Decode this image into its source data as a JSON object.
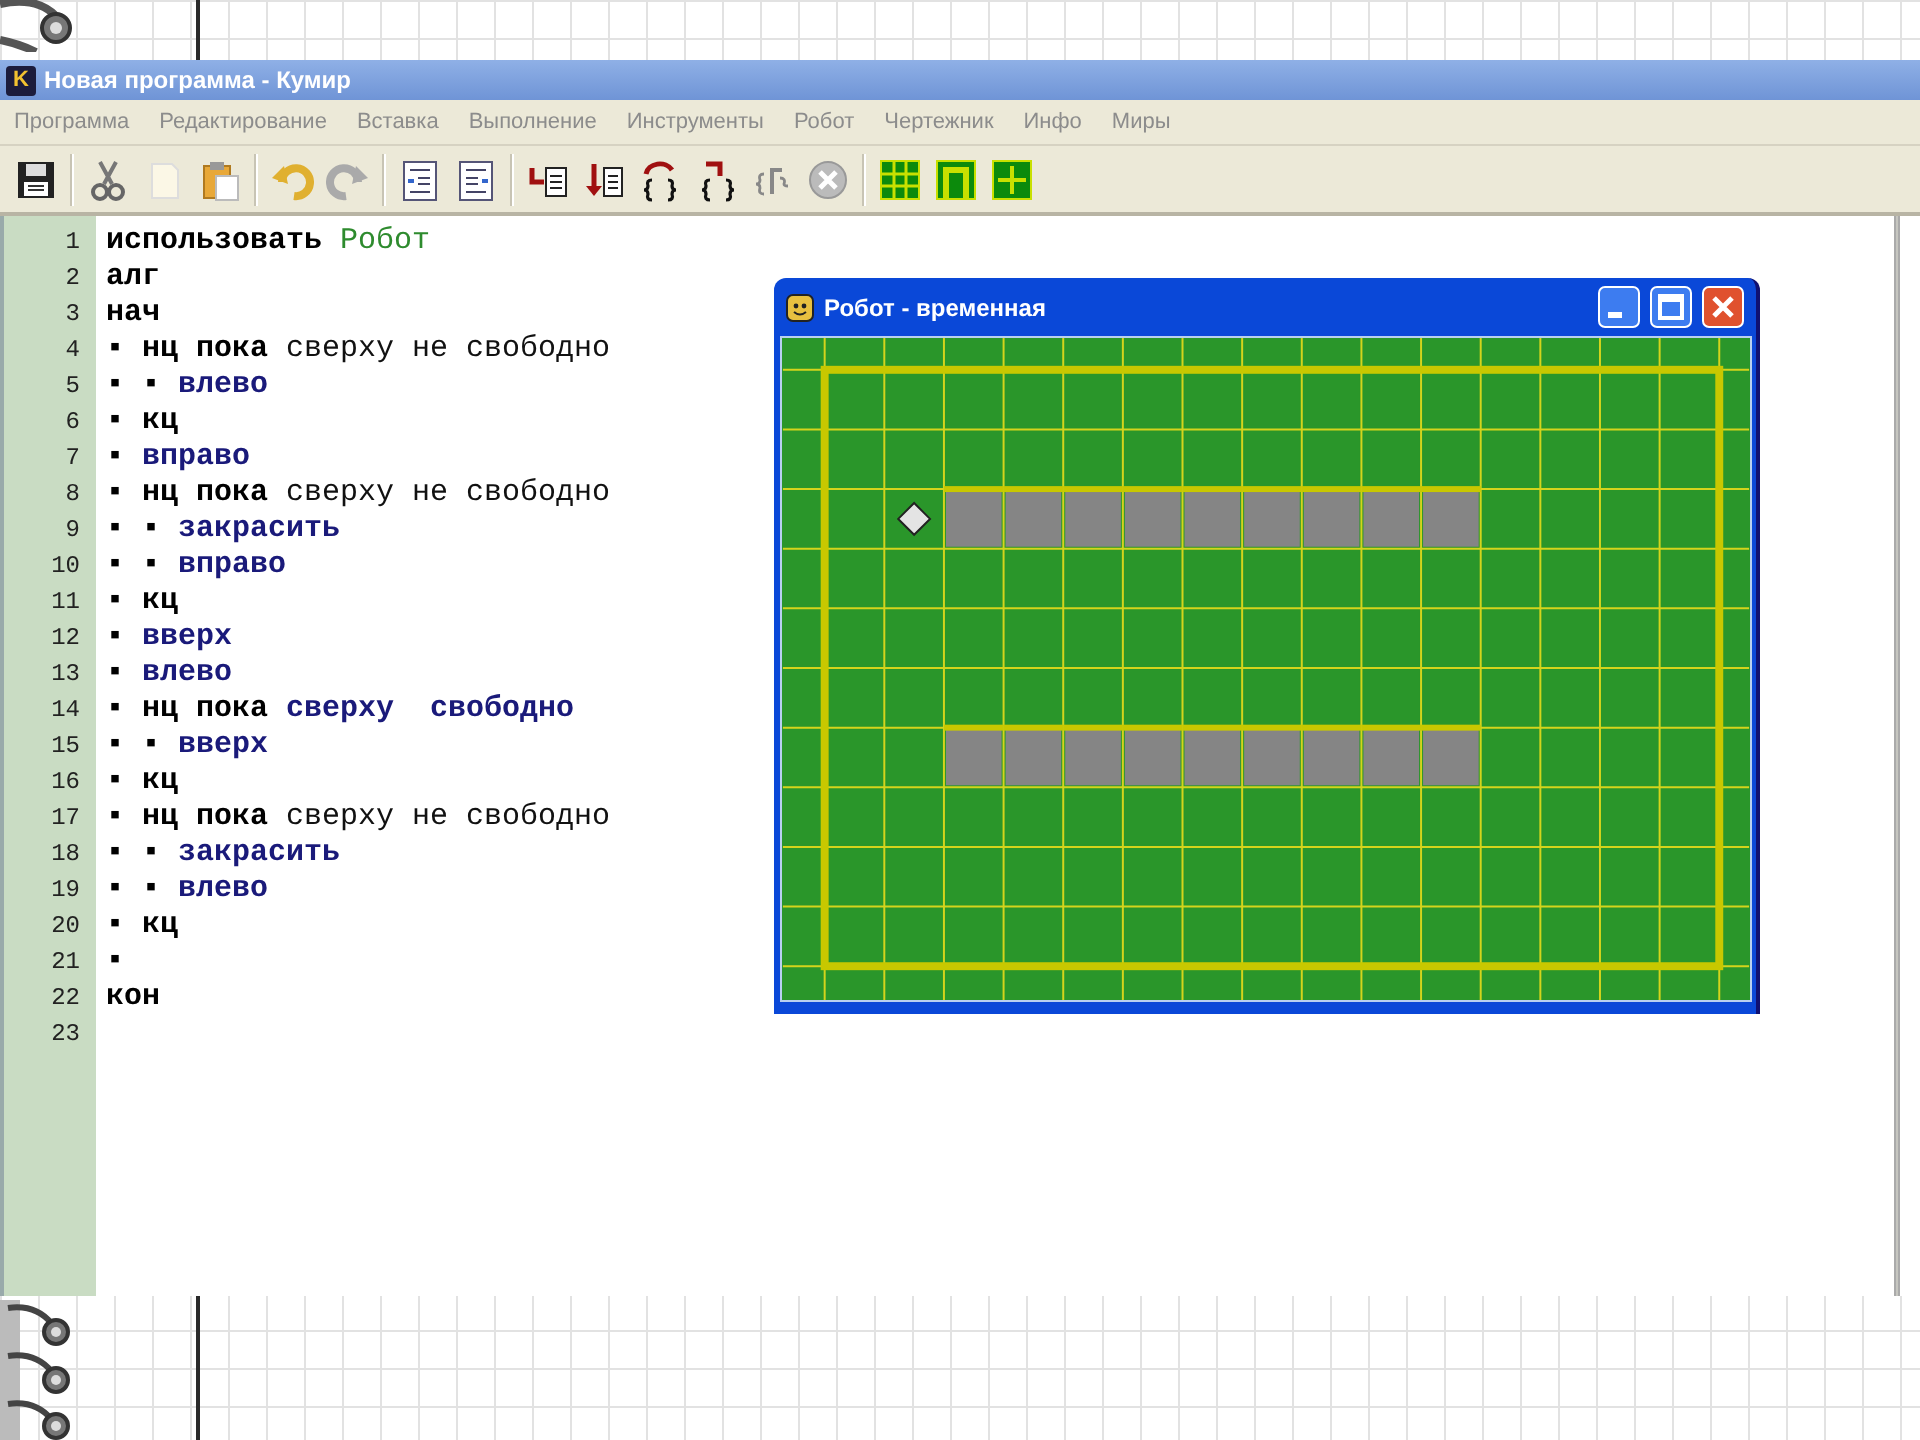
{
  "window": {
    "icon_letter": "K",
    "title": "Новая программа - Кумир"
  },
  "menu": [
    "Программа",
    "Редактирование",
    "Вставка",
    "Выполнение",
    "Инструменты",
    "Робот",
    "Чертежник",
    "Инфо",
    "Миры"
  ],
  "editor": {
    "lines": [
      {
        "number": "1",
        "segments": [
          {
            "kind": "keyword",
            "text": "использовать"
          },
          {
            "kind": "module",
            "text": "Робот"
          }
        ]
      },
      {
        "number": "2",
        "segments": [
          {
            "kind": "keyword",
            "text": "алг"
          }
        ]
      },
      {
        "number": "3",
        "segments": [
          {
            "kind": "keyword",
            "text": "нач"
          }
        ]
      },
      {
        "number": "4",
        "segments": [
          {
            "kind": "marker",
            "text": "▪"
          },
          {
            "kind": "keyword",
            "text": "нц пока"
          },
          {
            "kind": "condition",
            "text": "сверху не свободно"
          }
        ]
      },
      {
        "number": "5",
        "segments": [
          {
            "kind": "marker",
            "text": "▪"
          },
          {
            "kind": "marker",
            "text": "▪"
          },
          {
            "kind": "command",
            "text": "влево"
          }
        ]
      },
      {
        "number": "6",
        "segments": [
          {
            "kind": "marker",
            "text": "▪"
          },
          {
            "kind": "keyword",
            "text": "кц"
          }
        ]
      },
      {
        "number": "7",
        "segments": [
          {
            "kind": "marker",
            "text": "▪"
          },
          {
            "kind": "command",
            "text": "вправо"
          }
        ]
      },
      {
        "number": "8",
        "segments": [
          {
            "kind": "marker",
            "text": "▪"
          },
          {
            "kind": "keyword",
            "text": "нц пока"
          },
          {
            "kind": "condition",
            "text": "сверху не свободно"
          }
        ]
      },
      {
        "number": "9",
        "segments": [
          {
            "kind": "marker",
            "text": "▪"
          },
          {
            "kind": "marker",
            "text": "▪"
          },
          {
            "kind": "command",
            "text": "закрасить"
          }
        ]
      },
      {
        "number": "10",
        "segments": [
          {
            "kind": "marker",
            "text": "▪"
          },
          {
            "kind": "marker",
            "text": "▪"
          },
          {
            "kind": "command",
            "text": "вправо"
          }
        ]
      },
      {
        "number": "11",
        "segments": [
          {
            "kind": "marker",
            "text": "▪"
          },
          {
            "kind": "keyword",
            "text": "кц"
          }
        ]
      },
      {
        "number": "12",
        "segments": [
          {
            "kind": "marker",
            "text": "▪"
          },
          {
            "kind": "command",
            "text": "вверх"
          }
        ]
      },
      {
        "number": "13",
        "segments": [
          {
            "kind": "marker",
            "text": "▪"
          },
          {
            "kind": "command",
            "text": "влево"
          }
        ]
      },
      {
        "number": "14",
        "segments": [
          {
            "kind": "marker",
            "text": "▪"
          },
          {
            "kind": "keyword",
            "text": "нц пока"
          },
          {
            "kind": "command",
            "text": "сверху  свободно"
          }
        ]
      },
      {
        "number": "15",
        "segments": [
          {
            "kind": "marker",
            "text": "▪"
          },
          {
            "kind": "marker",
            "text": "▪"
          },
          {
            "kind": "command",
            "text": "вверх"
          }
        ]
      },
      {
        "number": "16",
        "segments": [
          {
            "kind": "marker",
            "text": "▪"
          },
          {
            "kind": "keyword",
            "text": "кц"
          }
        ]
      },
      {
        "number": "17",
        "segments": [
          {
            "kind": "marker",
            "text": "▪"
          },
          {
            "kind": "keyword",
            "text": "нц пока"
          },
          {
            "kind": "condition",
            "text": "сверху не свободно"
          }
        ]
      },
      {
        "number": "18",
        "segments": [
          {
            "kind": "marker",
            "text": "▪"
          },
          {
            "kind": "marker",
            "text": "▪"
          },
          {
            "kind": "command",
            "text": "закрасить"
          }
        ]
      },
      {
        "number": "19",
        "segments": [
          {
            "kind": "marker",
            "text": "▪"
          },
          {
            "kind": "marker",
            "text": "▪"
          },
          {
            "kind": "command",
            "text": "влево"
          }
        ]
      },
      {
        "number": "20",
        "segments": [
          {
            "kind": "marker",
            "text": "▪"
          },
          {
            "kind": "keyword",
            "text": "кц"
          }
        ]
      },
      {
        "number": "21",
        "segments": [
          {
            "kind": "marker",
            "text": "▪"
          }
        ]
      },
      {
        "number": "22",
        "segments": [
          {
            "kind": "keyword",
            "text": "кон"
          }
        ]
      },
      {
        "number": "23"
      }
    ]
  },
  "robot_window": {
    "title": "Робот - временная",
    "field": {
      "rows": [
        {
          "cells": [
            {
              "painted": false,
              "wall_top": false,
              "robot": false
            },
            {
              "painted": false,
              "wall_top": false,
              "robot": false
            },
            {
              "painted": false,
              "wall_top": false,
              "robot": false
            },
            {
              "painted": false,
              "wall_top": false,
              "robot": false
            },
            {
              "painted": false,
              "wall_top": false,
              "robot": false
            },
            {
              "painted": false,
              "wall_top": false,
              "robot": false
            },
            {
              "painted": false,
              "wall_top": false,
              "robot": false
            },
            {
              "painted": false,
              "wall_top": false,
              "robot": false
            },
            {
              "painted": false,
              "wall_top": false,
              "robot": false
            },
            {
              "painted": false,
              "wall_top": false,
              "robot": false
            },
            {
              "painted": false,
              "wall_top": false,
              "robot": false
            },
            {
              "painted": false,
              "wall_top": false,
              "robot": false
            },
            {
              "painted": false,
              "wall_top": false,
              "robot": false
            },
            {
              "painted": false,
              "wall_top": false,
              "robot": false
            },
            {
              "painted": false,
              "wall_top": false,
              "robot": false
            }
          ]
        },
        {
          "cells": [
            {
              "painted": false,
              "wall_top": false,
              "robot": false
            },
            {
              "painted": false,
              "wall_top": false,
              "robot": false
            },
            {
              "painted": false,
              "wall_top": false,
              "robot": false
            },
            {
              "painted": false,
              "wall_top": false,
              "robot": false
            },
            {
              "painted": false,
              "wall_top": false,
              "robot": false
            },
            {
              "painted": false,
              "wall_top": false,
              "robot": false
            },
            {
              "painted": false,
              "wall_top": false,
              "robot": false
            },
            {
              "painted": false,
              "wall_top": false,
              "robot": false
            },
            {
              "painted": false,
              "wall_top": false,
              "robot": false
            },
            {
              "painted": false,
              "wall_top": false,
              "robot": false
            },
            {
              "painted": false,
              "wall_top": false,
              "robot": false
            },
            {
              "painted": false,
              "wall_top": false,
              "robot": false
            },
            {
              "painted": false,
              "wall_top": false,
              "robot": false
            },
            {
              "painted": false,
              "wall_top": false,
              "robot": false
            },
            {
              "painted": false,
              "wall_top": false,
              "robot": false
            }
          ]
        },
        {
          "cells": [
            {
              "painted": false,
              "wall_top": false,
              "robot": false
            },
            {
              "painted": false,
              "wall_top": false,
              "robot": true
            },
            {
              "painted": true,
              "wall_top": true,
              "robot": false
            },
            {
              "painted": true,
              "wall_top": true,
              "robot": false
            },
            {
              "painted": true,
              "wall_top": true,
              "robot": false
            },
            {
              "painted": true,
              "wall_top": true,
              "robot": false
            },
            {
              "painted": true,
              "wall_top": true,
              "robot": false
            },
            {
              "painted": true,
              "wall_top": true,
              "robot": false
            },
            {
              "painted": true,
              "wall_top": true,
              "robot": false
            },
            {
              "painted": true,
              "wall_top": true,
              "robot": false
            },
            {
              "painted": true,
              "wall_top": true,
              "robot": false
            },
            {
              "painted": false,
              "wall_top": false,
              "robot": false
            },
            {
              "painted": false,
              "wall_top": false,
              "robot": false
            },
            {
              "painted": false,
              "wall_top": false,
              "robot": false
            },
            {
              "painted": false,
              "wall_top": false,
              "robot": false
            }
          ]
        },
        {
          "cells": [
            {
              "painted": false,
              "wall_top": false,
              "robot": false
            },
            {
              "painted": false,
              "wall_top": false,
              "robot": false
            },
            {
              "painted": false,
              "wall_top": false,
              "robot": false
            },
            {
              "painted": false,
              "wall_top": false,
              "robot": false
            },
            {
              "painted": false,
              "wall_top": false,
              "robot": false
            },
            {
              "painted": false,
              "wall_top": false,
              "robot": false
            },
            {
              "painted": false,
              "wall_top": false,
              "robot": false
            },
            {
              "painted": false,
              "wall_top": false,
              "robot": false
            },
            {
              "painted": false,
              "wall_top": false,
              "robot": false
            },
            {
              "painted": false,
              "wall_top": false,
              "robot": false
            },
            {
              "painted": false,
              "wall_top": false,
              "robot": false
            },
            {
              "painted": false,
              "wall_top": false,
              "robot": false
            },
            {
              "painted": false,
              "wall_top": false,
              "robot": false
            },
            {
              "painted": false,
              "wall_top": false,
              "robot": false
            },
            {
              "painted": false,
              "wall_top": false,
              "robot": false
            }
          ]
        },
        {
          "cells": [
            {
              "painted": false,
              "wall_top": false,
              "robot": false
            },
            {
              "painted": false,
              "wall_top": false,
              "robot": false
            },
            {
              "painted": false,
              "wall_top": false,
              "robot": false
            },
            {
              "painted": false,
              "wall_top": false,
              "robot": false
            },
            {
              "painted": false,
              "wall_top": false,
              "robot": false
            },
            {
              "painted": false,
              "wall_top": false,
              "robot": false
            },
            {
              "painted": false,
              "wall_top": false,
              "robot": false
            },
            {
              "painted": false,
              "wall_top": false,
              "robot": false
            },
            {
              "painted": false,
              "wall_top": false,
              "robot": false
            },
            {
              "painted": false,
              "wall_top": false,
              "robot": false
            },
            {
              "painted": false,
              "wall_top": false,
              "robot": false
            },
            {
              "painted": false,
              "wall_top": false,
              "robot": false
            },
            {
              "painted": false,
              "wall_top": false,
              "robot": false
            },
            {
              "painted": false,
              "wall_top": false,
              "robot": false
            },
            {
              "painted": false,
              "wall_top": false,
              "robot": false
            }
          ]
        },
        {
          "cells": [
            {
              "painted": false,
              "wall_top": false,
              "robot": false
            },
            {
              "painted": false,
              "wall_top": false,
              "robot": false
            },
            {
              "painted": false,
              "wall_top": false,
              "robot": false
            },
            {
              "painted": false,
              "wall_top": false,
              "robot": false
            },
            {
              "painted": false,
              "wall_top": false,
              "robot": false
            },
            {
              "painted": false,
              "wall_top": false,
              "robot": false
            },
            {
              "painted": false,
              "wall_top": false,
              "robot": false
            },
            {
              "painted": false,
              "wall_top": false,
              "robot": false
            },
            {
              "painted": false,
              "wall_top": false,
              "robot": false
            },
            {
              "painted": false,
              "wall_top": false,
              "robot": false
            },
            {
              "painted": false,
              "wall_top": false,
              "robot": false
            },
            {
              "painted": false,
              "wall_top": false,
              "robot": false
            },
            {
              "painted": false,
              "wall_top": false,
              "robot": false
            },
            {
              "painted": false,
              "wall_top": false,
              "robot": false
            },
            {
              "painted": false,
              "wall_top": false,
              "robot": false
            }
          ]
        },
        {
          "cells": [
            {
              "painted": false,
              "wall_top": false,
              "robot": false
            },
            {
              "painted": false,
              "wall_top": false,
              "robot": false
            },
            {
              "painted": true,
              "wall_top": true,
              "robot": false
            },
            {
              "painted": true,
              "wall_top": true,
              "robot": false
            },
            {
              "painted": true,
              "wall_top": true,
              "robot": false
            },
            {
              "painted": true,
              "wall_top": true,
              "robot": false
            },
            {
              "painted": true,
              "wall_top": true,
              "robot": false
            },
            {
              "painted": true,
              "wall_top": true,
              "robot": false
            },
            {
              "painted": true,
              "wall_top": true,
              "robot": false
            },
            {
              "painted": true,
              "wall_top": true,
              "robot": false
            },
            {
              "painted": true,
              "wall_top": true,
              "robot": false
            },
            {
              "painted": false,
              "wall_top": false,
              "robot": false
            },
            {
              "painted": false,
              "wall_top": false,
              "robot": false
            },
            {
              "painted": false,
              "wall_top": false,
              "robot": false
            },
            {
              "painted": false,
              "wall_top": false,
              "robot": false
            }
          ]
        },
        {
          "cells": [
            {
              "painted": false,
              "wall_top": false,
              "robot": false
            },
            {
              "painted": false,
              "wall_top": false,
              "robot": false
            },
            {
              "painted": false,
              "wall_top": false,
              "robot": false
            },
            {
              "painted": false,
              "wall_top": false,
              "robot": false
            },
            {
              "painted": false,
              "wall_top": false,
              "robot": false
            },
            {
              "painted": false,
              "wall_top": false,
              "robot": false
            },
            {
              "painted": false,
              "wall_top": false,
              "robot": false
            },
            {
              "painted": false,
              "wall_top": false,
              "robot": false
            },
            {
              "painted": false,
              "wall_top": false,
              "robot": false
            },
            {
              "painted": false,
              "wall_top": false,
              "robot": false
            },
            {
              "painted": false,
              "wall_top": false,
              "robot": false
            },
            {
              "painted": false,
              "wall_top": false,
              "robot": false
            },
            {
              "painted": false,
              "wall_top": false,
              "robot": false
            },
            {
              "painted": false,
              "wall_top": false,
              "robot": false
            },
            {
              "painted": false,
              "wall_top": false,
              "robot": false
            }
          ]
        },
        {
          "cells": [
            {
              "painted": false,
              "wall_top": false,
              "robot": false
            },
            {
              "painted": false,
              "wall_top": false,
              "robot": false
            },
            {
              "painted": false,
              "wall_top": false,
              "robot": false
            },
            {
              "painted": false,
              "wall_top": false,
              "robot": false
            },
            {
              "painted": false,
              "wall_top": false,
              "robot": false
            },
            {
              "painted": false,
              "wall_top": false,
              "robot": false
            },
            {
              "painted": false,
              "wall_top": false,
              "robot": false
            },
            {
              "painted": false,
              "wall_top": false,
              "robot": false
            },
            {
              "painted": false,
              "wall_top": false,
              "robot": false
            },
            {
              "painted": false,
              "wall_top": false,
              "robot": false
            },
            {
              "painted": false,
              "wall_top": false,
              "robot": false
            },
            {
              "painted": false,
              "wall_top": false,
              "robot": false
            },
            {
              "painted": false,
              "wall_top": false,
              "robot": false
            },
            {
              "painted": false,
              "wall_top": false,
              "robot": false
            },
            {
              "painted": false,
              "wall_top": false,
              "robot": false
            }
          ]
        },
        {
          "cells": [
            {
              "painted": false,
              "wall_top": false,
              "robot": false
            },
            {
              "painted": false,
              "wall_top": false,
              "robot": false
            },
            {
              "painted": false,
              "wall_top": false,
              "robot": false
            },
            {
              "painted": false,
              "wall_top": false,
              "robot": false
            },
            {
              "painted": false,
              "wall_top": false,
              "robot": false
            },
            {
              "painted": false,
              "wall_top": false,
              "robot": false
            },
            {
              "painted": false,
              "wall_top": false,
              "robot": false
            },
            {
              "painted": false,
              "wall_top": false,
              "robot": false
            },
            {
              "painted": false,
              "wall_top": false,
              "robot": false
            },
            {
              "painted": false,
              "wall_top": false,
              "robot": false
            },
            {
              "painted": false,
              "wall_top": false,
              "robot": false
            },
            {
              "painted": false,
              "wall_top": false,
              "robot": false
            },
            {
              "painted": false,
              "wall_top": false,
              "robot": false
            },
            {
              "painted": false,
              "wall_top": false,
              "robot": false
            },
            {
              "painted": false,
              "wall_top": false,
              "robot": false
            }
          ]
        }
      ]
    }
  }
}
